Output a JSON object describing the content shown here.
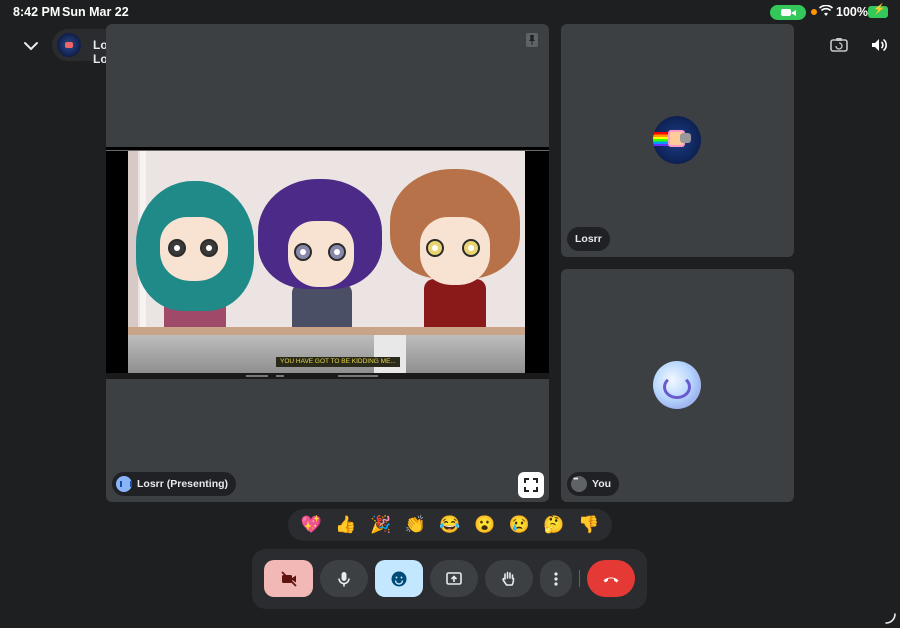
{
  "status_bar": {
    "time": "8:42 PM",
    "date": "Sun Mar 22",
    "battery": "100%"
  },
  "header": {
    "collapse_icon": "chevron-down-icon",
    "meeting_title": "Losrr, Losrr",
    "tools": [
      "switch-camera-icon",
      "speaker-icon"
    ]
  },
  "tiles": {
    "main": {
      "name_label": "Losrr (Presenting)",
      "shared_screen_subtitle": "YOU HAVE GOT TO BE KIDDING ME..."
    },
    "participant": {
      "name_label": "Losrr"
    },
    "self": {
      "name_label": "You"
    }
  },
  "reactions": [
    "💖",
    "👍",
    "🎉",
    "👏",
    "😂",
    "😮",
    "😢",
    "🤔",
    "👎"
  ],
  "controls": [
    {
      "name": "camera-off-button",
      "icon": "video-off-icon"
    },
    {
      "name": "microphone-button",
      "icon": "mic-icon"
    },
    {
      "name": "reactions-button",
      "icon": "emoji-icon"
    },
    {
      "name": "present-button",
      "icon": "present-screen-icon"
    },
    {
      "name": "raise-hand-button",
      "icon": "hand-icon"
    },
    {
      "name": "more-options-button",
      "icon": "more-vert-icon"
    },
    {
      "name": "leave-call-button",
      "icon": "call-end-icon"
    }
  ],
  "colors": {
    "background": "#1e1f20",
    "tile": "#3c4043",
    "accent_blue": "#8ab4f8",
    "leave_red": "#e53935",
    "camera_off_pink": "#f2b8b5",
    "reactions_active": "#c2e7ff",
    "recording_green": "#34c759"
  }
}
